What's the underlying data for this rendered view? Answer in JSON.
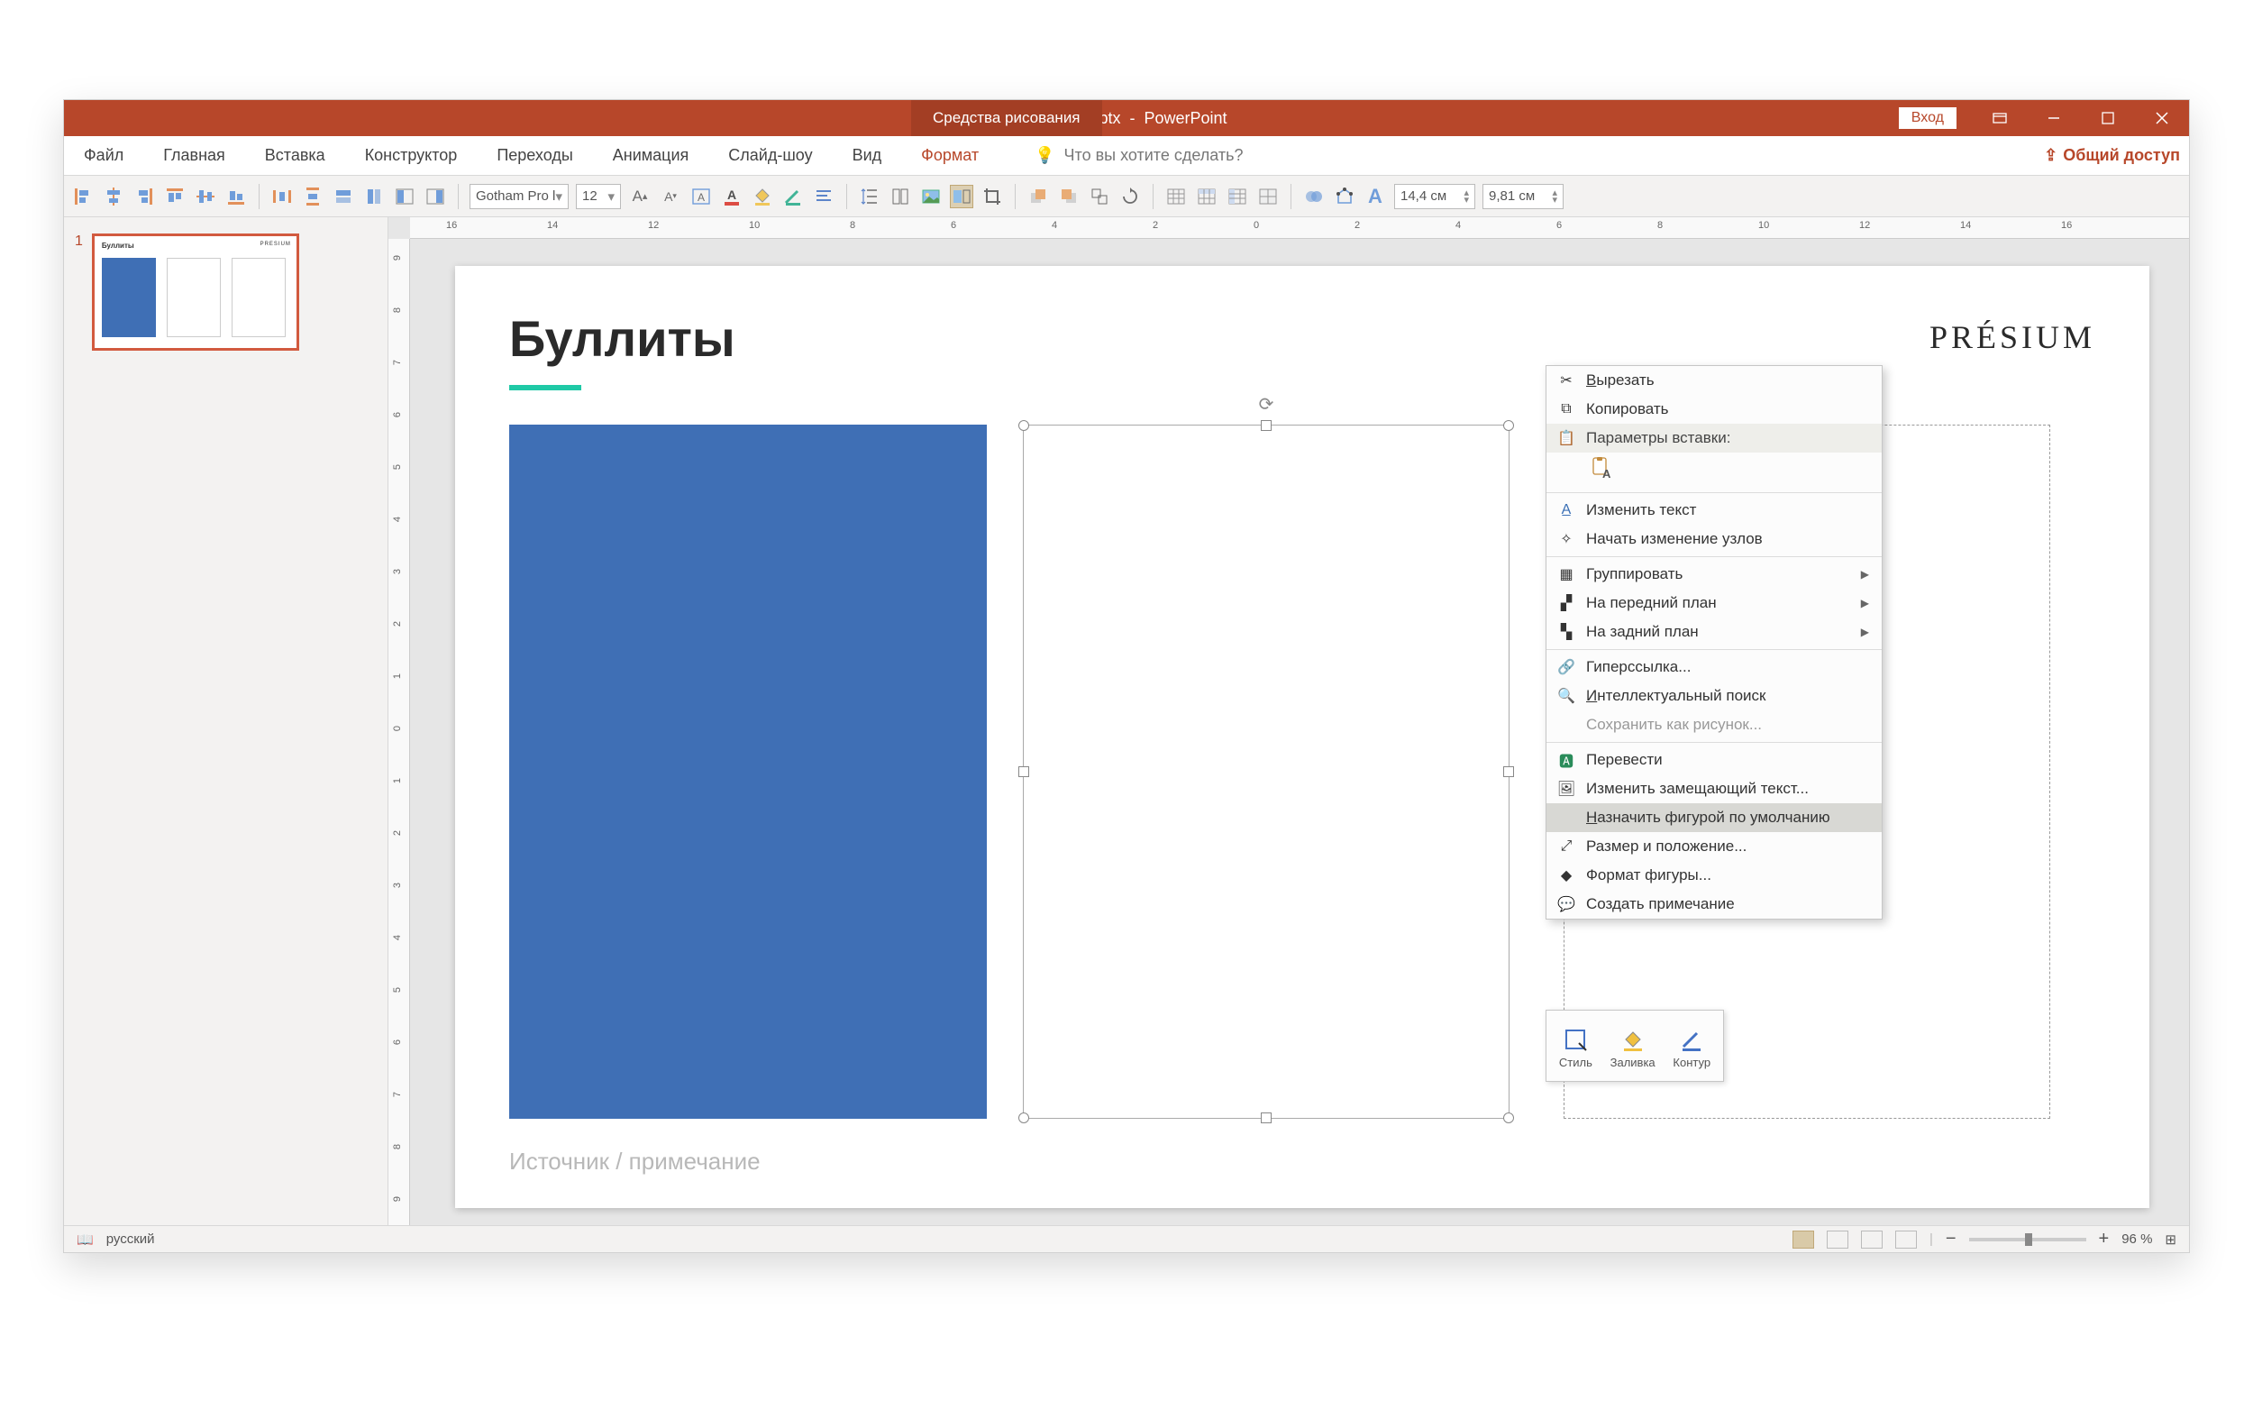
{
  "titlebar": {
    "filename": "Presium.pptx",
    "app": "PowerPoint",
    "tools_tab": "Средства рисования",
    "login": "Вход"
  },
  "menu": {
    "file": "Файл",
    "home": "Главная",
    "insert": "Вставка",
    "design": "Конструктор",
    "transitions": "Переходы",
    "animations": "Анимация",
    "slideshow": "Слайд-шоу",
    "view": "Вид",
    "format": "Формат",
    "tellme": "Что вы хотите сделать?",
    "share": "Общий доступ"
  },
  "toolbar": {
    "font": "Gotham Pro l",
    "fontsize": "12",
    "height": "14,4 см",
    "width": "9,81 см"
  },
  "thumb": {
    "num": "1",
    "mini_title": "Буллиты",
    "mini_logo": "PRESIUM"
  },
  "slide": {
    "title": "Буллиты",
    "logo": "PRÉSIUM",
    "source": "Источник / примечание"
  },
  "context": {
    "cut": "Вырезать",
    "copy": "Копировать",
    "paste_options": "Параметры вставки:",
    "edit_text": "Изменить текст",
    "edit_points": "Начать изменение узлов",
    "group": "Группировать",
    "bring_front": "На передний план",
    "send_back": "На задний план",
    "hyperlink": "Гиперссылка...",
    "smart_lookup": "Интеллектуальный поиск",
    "save_as_picture": "Сохранить как рисунок...",
    "translate": "Перевести",
    "alt_text": "Изменить замещающий текст...",
    "set_default": "Назначить фигурой по умолчанию",
    "size_position": "Размер и положение...",
    "format_shape": "Формат фигуры...",
    "new_comment": "Создать примечание"
  },
  "mini_toolbar": {
    "style": "Стиль",
    "fill": "Заливка",
    "outline": "Контур"
  },
  "statusbar": {
    "lang": "русский",
    "zoom": "96 %"
  },
  "ruler": {
    "h": [
      "16",
      "14",
      "12",
      "10",
      "8",
      "6",
      "4",
      "2",
      "0",
      "2",
      "4",
      "6",
      "8",
      "10",
      "12",
      "14",
      "16"
    ],
    "v": [
      "9",
      "8",
      "7",
      "6",
      "5",
      "4",
      "3",
      "2",
      "1",
      "0",
      "1",
      "2",
      "3",
      "4",
      "5",
      "6",
      "7",
      "8",
      "9"
    ]
  }
}
